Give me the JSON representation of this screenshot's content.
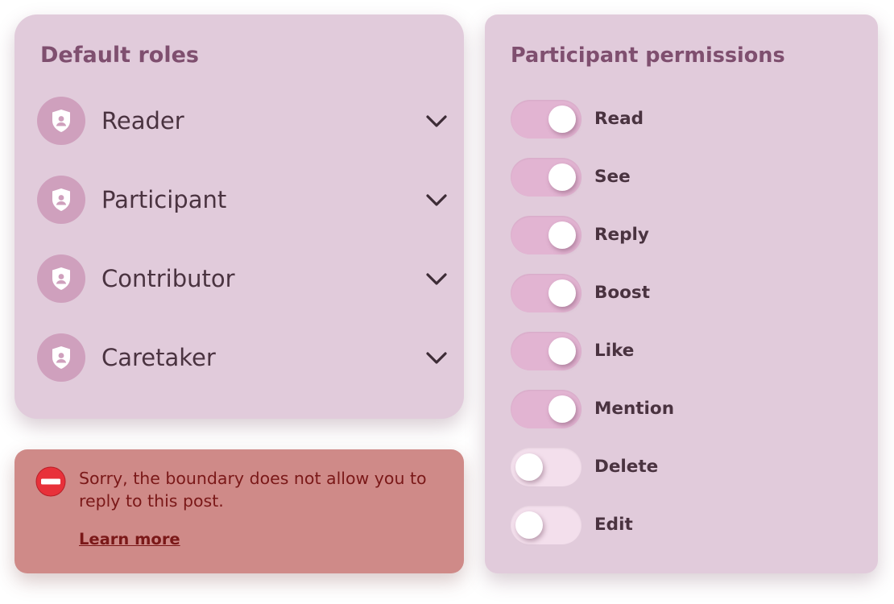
{
  "roles_panel": {
    "title": "Default roles",
    "roles": [
      {
        "label": "Reader",
        "icon": "shield-user-icon"
      },
      {
        "label": "Participant",
        "icon": "shield-user-icon"
      },
      {
        "label": "Contributor",
        "icon": "shield-user-icon"
      },
      {
        "label": "Caretaker",
        "icon": "shield-user-icon"
      }
    ]
  },
  "permissions_panel": {
    "title": "Participant permissions",
    "items": [
      {
        "label": "Read",
        "enabled": true
      },
      {
        "label": "See",
        "enabled": true
      },
      {
        "label": "Reply",
        "enabled": true
      },
      {
        "label": "Boost",
        "enabled": true
      },
      {
        "label": "Like",
        "enabled": true
      },
      {
        "label": "Mention",
        "enabled": true
      },
      {
        "label": "Delete",
        "enabled": false
      },
      {
        "label": "Edit",
        "enabled": false
      }
    ]
  },
  "alert": {
    "icon": "no-entry-icon",
    "message": "Sorry, the boundary does not allow you to reply to this post.",
    "link_label": "Learn more"
  },
  "colors": {
    "card_background": "#e1cbdb",
    "title": "#7f4f6f",
    "text": "#4a3340",
    "toggle_on": "#e2b4d2",
    "toggle_off": "#f3dfec",
    "alert_background": "#cf8a88",
    "alert_text": "#7a1818",
    "alert_icon": "#e8313a"
  }
}
